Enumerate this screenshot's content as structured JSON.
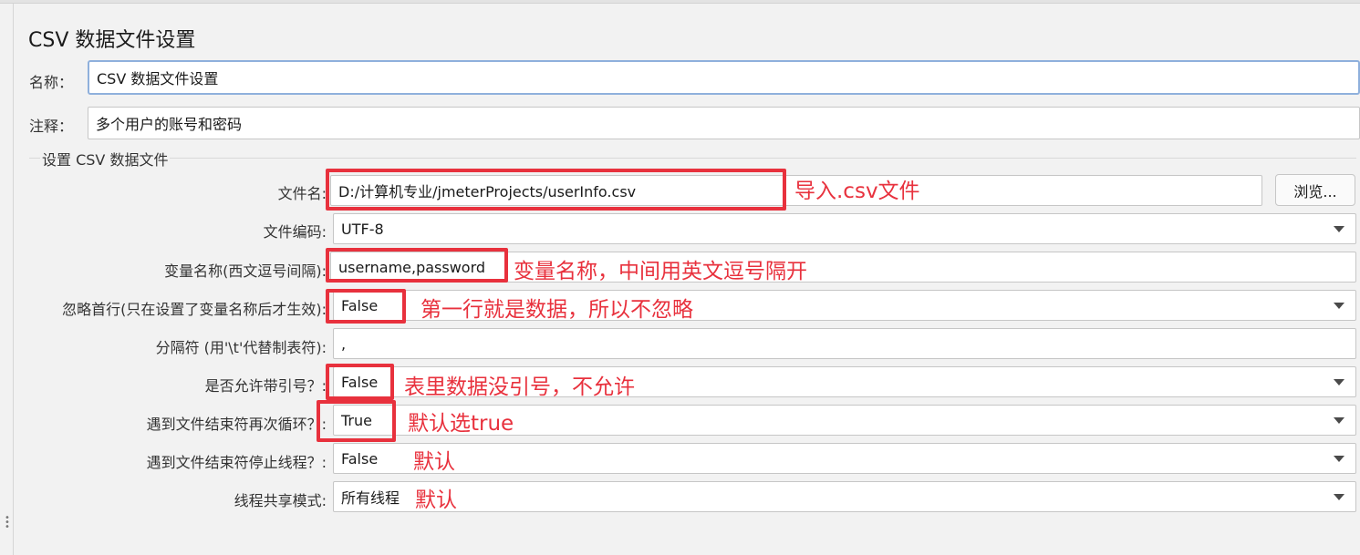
{
  "panel": {
    "title": "CSV 数据文件设置",
    "name_label": "名称：",
    "name_value": "CSV 数据文件设置",
    "comment_label": "注释：",
    "comment_value": "多个用户的账号和密码"
  },
  "group": {
    "title": "设置 CSV 数据文件",
    "filename_label": "文件名:",
    "filename_value": "D:/计算机专业/jmeterProjects/userInfo.csv",
    "browse_label": "浏览...",
    "encoding_label": "文件编码:",
    "encoding_value": "UTF-8",
    "varnames_label": "变量名称(西文逗号间隔):",
    "varnames_value": "username,password",
    "ignore_first_label": "忽略首行(只在设置了变量名称后才生效):",
    "ignore_first_value": "False",
    "delimiter_label": "分隔符 (用'\\t'代替制表符):",
    "delimiter_value": ",",
    "quoted_label": "是否允许带引号？:",
    "quoted_value": "False",
    "recycle_label": "遇到文件结束符再次循环？:",
    "recycle_value": "True",
    "stop_label": "遇到文件结束符停止线程？:",
    "stop_value": "False",
    "share_label": "线程共享模式:",
    "share_value": "所有线程"
  },
  "annotations": {
    "filename": "导入.csv文件",
    "varnames": "变量名称，中间用英文逗号隔开",
    "ignore_first": "第一行就是数据，所以不忽略",
    "quoted": "表里数据没引号，不允许",
    "recycle": "默认选true",
    "stop": "默认",
    "share": "默认",
    "color": "#e8313d"
  }
}
